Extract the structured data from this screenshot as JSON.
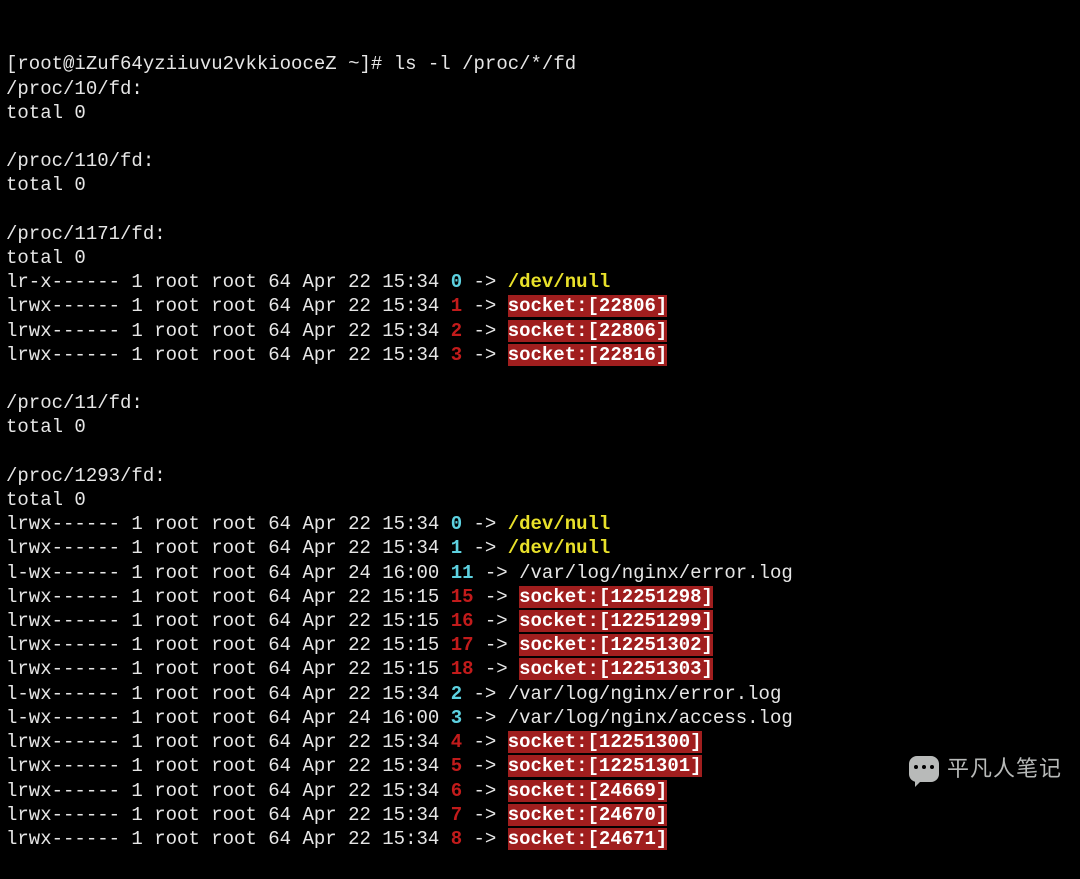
{
  "prompt": {
    "open": "[",
    "user_host": "root@iZuf64yziiuvu2vkkiooceZ",
    "cwd": " ~",
    "close": "]# ",
    "command": "ls -l /proc/*/fd"
  },
  "dirs": [
    {
      "header": "/proc/10/fd:",
      "total": "total 0",
      "entries": []
    },
    {
      "header": "/proc/110/fd:",
      "total": "total 0",
      "entries": []
    },
    {
      "header": "/proc/1171/fd:",
      "total": "total 0",
      "entries": [
        {
          "perm": "lr-x------",
          "meta": " 1 root root 64 Apr 22 15:34 ",
          "fd": "0",
          "fdc": "cyan",
          "arrow": " -> ",
          "target": "/dev/null",
          "style": "yellow"
        },
        {
          "perm": "lrwx------",
          "meta": " 1 root root 64 Apr 22 15:34 ",
          "fd": "1",
          "fdc": "red",
          "arrow": " -> ",
          "target": "socket:[22806]",
          "style": "socket"
        },
        {
          "perm": "lrwx------",
          "meta": " 1 root root 64 Apr 22 15:34 ",
          "fd": "2",
          "fdc": "red",
          "arrow": " -> ",
          "target": "socket:[22806]",
          "style": "socket"
        },
        {
          "perm": "lrwx------",
          "meta": " 1 root root 64 Apr 22 15:34 ",
          "fd": "3",
          "fdc": "red",
          "arrow": " -> ",
          "target": "socket:[22816]",
          "style": "socket"
        }
      ]
    },
    {
      "header": "/proc/11/fd:",
      "total": "total 0",
      "entries": []
    },
    {
      "header": "/proc/1293/fd:",
      "total": "total 0",
      "entries": [
        {
          "perm": "lrwx------",
          "meta": " 1 root root 64 Apr 22 15:34 ",
          "fd": "0",
          "fdc": "cyan",
          "arrow": " -> ",
          "target": "/dev/null",
          "style": "yellow"
        },
        {
          "perm": "lrwx------",
          "meta": " 1 root root 64 Apr 22 15:34 ",
          "fd": "1",
          "fdc": "cyan",
          "arrow": " -> ",
          "target": "/dev/null",
          "style": "yellow"
        },
        {
          "perm": "l-wx------",
          "meta": " 1 root root 64 Apr 24 16:00 ",
          "fd": "11",
          "fdc": "cyan",
          "arrow": " -> ",
          "target": "/var/log/nginx/error.log",
          "style": "white"
        },
        {
          "perm": "lrwx------",
          "meta": " 1 root root 64 Apr 22 15:15 ",
          "fd": "15",
          "fdc": "red",
          "arrow": " -> ",
          "target": "socket:[12251298]",
          "style": "socket"
        },
        {
          "perm": "lrwx------",
          "meta": " 1 root root 64 Apr 22 15:15 ",
          "fd": "16",
          "fdc": "red",
          "arrow": " -> ",
          "target": "socket:[12251299]",
          "style": "socket"
        },
        {
          "perm": "lrwx------",
          "meta": " 1 root root 64 Apr 22 15:15 ",
          "fd": "17",
          "fdc": "red",
          "arrow": " -> ",
          "target": "socket:[12251302]",
          "style": "socket"
        },
        {
          "perm": "lrwx------",
          "meta": " 1 root root 64 Apr 22 15:15 ",
          "fd": "18",
          "fdc": "red",
          "arrow": " -> ",
          "target": "socket:[12251303]",
          "style": "socket"
        },
        {
          "perm": "l-wx------",
          "meta": " 1 root root 64 Apr 22 15:34 ",
          "fd": "2",
          "fdc": "cyan",
          "arrow": " -> ",
          "target": "/var/log/nginx/error.log",
          "style": "white"
        },
        {
          "perm": "l-wx------",
          "meta": " 1 root root 64 Apr 24 16:00 ",
          "fd": "3",
          "fdc": "cyan",
          "arrow": " -> ",
          "target": "/var/log/nginx/access.log",
          "style": "white"
        },
        {
          "perm": "lrwx------",
          "meta": " 1 root root 64 Apr 22 15:34 ",
          "fd": "4",
          "fdc": "red",
          "arrow": " -> ",
          "target": "socket:[12251300]",
          "style": "socket"
        },
        {
          "perm": "lrwx------",
          "meta": " 1 root root 64 Apr 22 15:34 ",
          "fd": "5",
          "fdc": "red",
          "arrow": " -> ",
          "target": "socket:[12251301]",
          "style": "socket"
        },
        {
          "perm": "lrwx------",
          "meta": " 1 root root 64 Apr 22 15:34 ",
          "fd": "6",
          "fdc": "red",
          "arrow": " -> ",
          "target": "socket:[24669]",
          "style": "socket"
        },
        {
          "perm": "lrwx------",
          "meta": " 1 root root 64 Apr 22 15:34 ",
          "fd": "7",
          "fdc": "red",
          "arrow": " -> ",
          "target": "socket:[24670]",
          "style": "socket"
        },
        {
          "perm": "lrwx------",
          "meta": " 1 root root 64 Apr 22 15:34 ",
          "fd": "8",
          "fdc": "red",
          "arrow": " -> ",
          "target": "socket:[24671]",
          "style": "socket"
        }
      ]
    }
  ],
  "watermark": "平凡人笔记"
}
